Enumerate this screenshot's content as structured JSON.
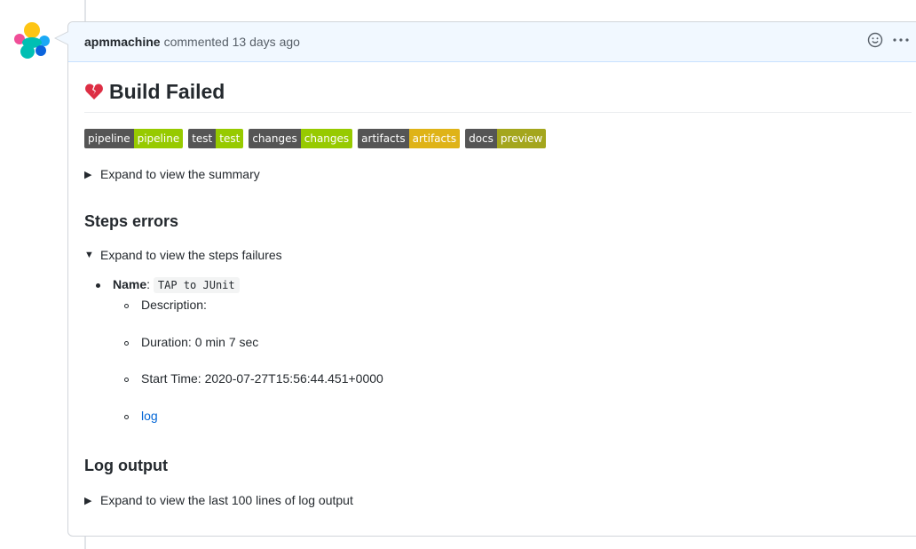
{
  "comment": {
    "author": "apmmachine",
    "action": "commented",
    "time": "13 days ago",
    "icons": [
      "smiley-icon",
      "kebab-menu-icon"
    ]
  },
  "title": {
    "emoji": "broken-heart-icon",
    "text": "Build Failed"
  },
  "badges": [
    {
      "left": "pipeline",
      "right": "pipeline",
      "color": "#97ca00"
    },
    {
      "left": "test",
      "right": "test",
      "color": "#97ca00"
    },
    {
      "left": "changes",
      "right": "changes",
      "color": "#97ca00"
    },
    {
      "left": "artifacts",
      "right": "artifacts",
      "color": "#dfb317"
    },
    {
      "left": "docs",
      "right": "preview",
      "color": "#a4a61d"
    }
  ],
  "summary_toggle": "Expand to view the summary",
  "steps_errors_heading": "Steps errors",
  "steps_toggle": "Expand to view the steps failures",
  "step": {
    "name_label": "Name",
    "name_value": "TAP to JUnit",
    "description": "Description:",
    "duration": "Duration: 0 min 7 sec",
    "start_time": "Start Time: 2020-07-27T15:56:44.451+0000",
    "log_link": "log"
  },
  "log_output_heading": "Log output",
  "log_toggle": "Expand to view the last 100 lines of log output"
}
